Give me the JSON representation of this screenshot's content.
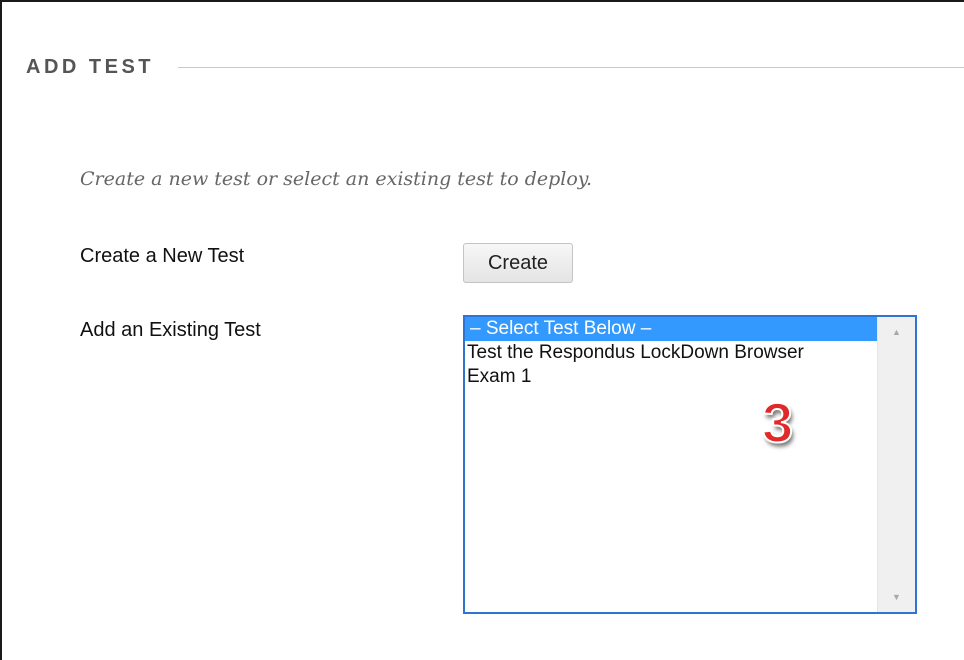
{
  "section": {
    "title": "ADD TEST"
  },
  "instructions": "Create a new test or select an existing test to deploy.",
  "create_field": {
    "label": "Create a New Test",
    "button_label": "Create"
  },
  "existing_field": {
    "label": "Add an Existing Test",
    "options": [
      "– Select Test Below –",
      "Test the Respondus LockDown Browser",
      "Exam 1"
    ],
    "selected_index": 0
  },
  "annotation": {
    "step_number": "3",
    "color": "#e02a2a"
  },
  "colors": {
    "listbox_border": "#2f74d0",
    "selection_background": "#3399ff",
    "section_title": "#555555"
  }
}
